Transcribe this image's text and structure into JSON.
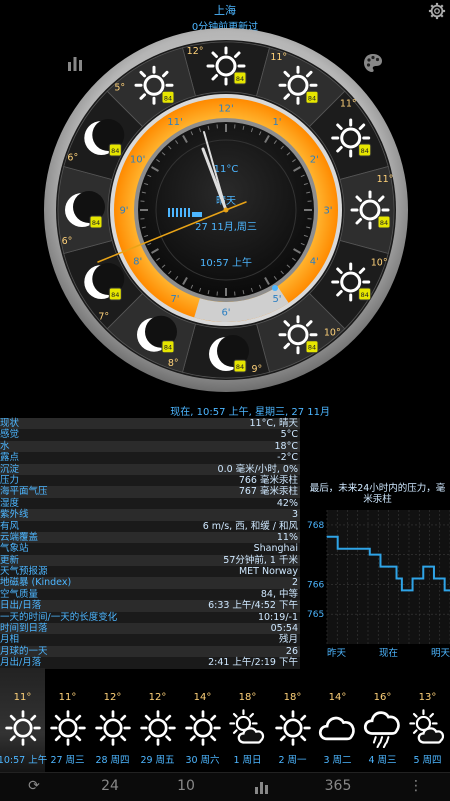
{
  "header": {
    "city": "上海",
    "updated": "0分钟前更新过"
  },
  "dial": {
    "hour_labels": [
      "12'",
      "1'",
      "2'",
      "3'",
      "4'",
      "5'",
      "6'",
      "7'",
      "8'",
      "9'",
      "10'",
      "11'"
    ],
    "inner_temp": "11°C",
    "inner_cond": "晴天",
    "inner_date": "27 11月,周三",
    "inner_time": "10:57 上午",
    "sector_temps": [
      "12°",
      "11°",
      "11°",
      "11°",
      "10°",
      "10°",
      "9°",
      "8°",
      "7°",
      "6°",
      "6°",
      "5°",
      "10°",
      "11°"
    ]
  },
  "now_line": "现在, 10:57 上午, 星期三, 27 11月",
  "conditions": [
    {
      "label": "现状",
      "value": "11°C, 晴天"
    },
    {
      "label": "感觉",
      "value": "5°C"
    },
    {
      "label": "水",
      "value": "18°C"
    },
    {
      "label": "露点",
      "value": "-2°C"
    },
    {
      "label": "沉淀",
      "value": "0.0 毫米/小时, 0%"
    },
    {
      "label": "压力",
      "value": "766 毫米汞柱"
    },
    {
      "label": "海平面气压",
      "value": "767 毫米汞柱"
    },
    {
      "label": "湿度",
      "value": "42%"
    },
    {
      "label": "紫外线",
      "value": "3"
    },
    {
      "label": "有风",
      "value": "6 m/s, 西, 和缓 / 和风"
    },
    {
      "label": "云端覆盖",
      "value": "11%"
    },
    {
      "label": "气象站",
      "value": "Shanghai"
    },
    {
      "label": "更新",
      "value": "57分钟前, 1 千米"
    },
    {
      "label": "天气预报源",
      "value": "MET Norway"
    },
    {
      "label": "地磁暴 (Kindex)",
      "value": "2"
    },
    {
      "label": "空气质量",
      "value": "84, 中等"
    },
    {
      "label": "日出/日落",
      "value": "6:33 上午/4:52 下午"
    },
    {
      "label": "一天的时间/一天的长度变化",
      "value": "10:19/-1"
    },
    {
      "label": "时间到日落",
      "value": "05:54"
    },
    {
      "label": "月相",
      "value": "残月"
    },
    {
      "label": "月球的一天",
      "value": "26"
    },
    {
      "label": "月出/月落",
      "value": "2:41 上午/2:19 下午"
    }
  ],
  "pressure": {
    "title": "最后，未来24小时内的压力，毫米汞柱",
    "y_ticks": [
      "768",
      "766",
      "765"
    ],
    "x_labels": [
      "昨天",
      "现在",
      "明天"
    ]
  },
  "chart_data": {
    "type": "line",
    "title": "最后，未来24小时内的压力，毫米汞柱",
    "x": [
      "昨天",
      "",
      "",
      "",
      "",
      "",
      "",
      "",
      "",
      "",
      "",
      "现在",
      "",
      "",
      "",
      "",
      "",
      "",
      "",
      "",
      "",
      "",
      "",
      "明天"
    ],
    "series": [
      {
        "values": [
          767.6,
          767.6,
          767.2,
          767.2,
          767.2,
          767.2,
          767.2,
          767.2,
          767.0,
          767.0,
          766.6,
          766.6,
          766.6,
          766.2,
          765.8,
          765.8,
          766.2,
          766.2,
          766.6,
          766.6,
          766.2,
          766.2,
          765.8,
          765.8
        ]
      }
    ],
    "ylim": [
      764,
      768.5
    ],
    "xlabel": "",
    "ylabel": ""
  },
  "forecast": [
    {
      "temp": "11°",
      "label": "10:57 上午",
      "icon": "sun-icon",
      "now": true
    },
    {
      "temp": "11°",
      "label": "27 周三",
      "icon": "sun-icon"
    },
    {
      "temp": "12°",
      "label": "28 周四",
      "icon": "sun-icon"
    },
    {
      "temp": "12°",
      "label": "29 周五",
      "icon": "sun-icon"
    },
    {
      "temp": "14°",
      "label": "30 周六",
      "icon": "sun-icon"
    },
    {
      "temp": "18°",
      "label": "1 周日",
      "icon": "partly-cloudy-icon"
    },
    {
      "temp": "18°",
      "label": "2 周一",
      "icon": "sun-icon"
    },
    {
      "temp": "14°",
      "label": "3 周二",
      "icon": "cloud-icon"
    },
    {
      "temp": "16°",
      "label": "4 周三",
      "icon": "rain-cloud-icon"
    },
    {
      "temp": "13°",
      "label": "5 周四",
      "icon": "partly-cloudy-icon"
    }
  ],
  "bottom_bar": {
    "refresh": "⟳",
    "h24": "24",
    "d10": "10",
    "chart": "",
    "d365": "365",
    "more": "⋮"
  }
}
